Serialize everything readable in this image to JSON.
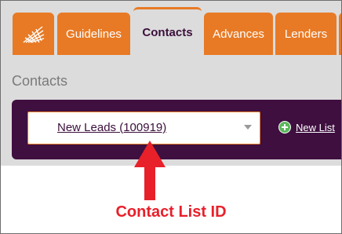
{
  "tabs": {
    "logo_icon": "chart-logo-icon",
    "items": [
      {
        "label": "Guidelines"
      },
      {
        "label": "Contacts"
      },
      {
        "label": "Advances"
      },
      {
        "label": "Lenders"
      }
    ],
    "active_index": 1
  },
  "page": {
    "heading": "Contacts"
  },
  "contact_bar": {
    "select_value": "New Leads (100919)",
    "new_list_label": "New List"
  },
  "annotation": {
    "text": "Contact List ID"
  },
  "colors": {
    "accent_orange": "#e87a25",
    "bar_purple": "#3f0f40",
    "annotation_red": "#e8202a",
    "plus_green": "#5cb85c"
  }
}
